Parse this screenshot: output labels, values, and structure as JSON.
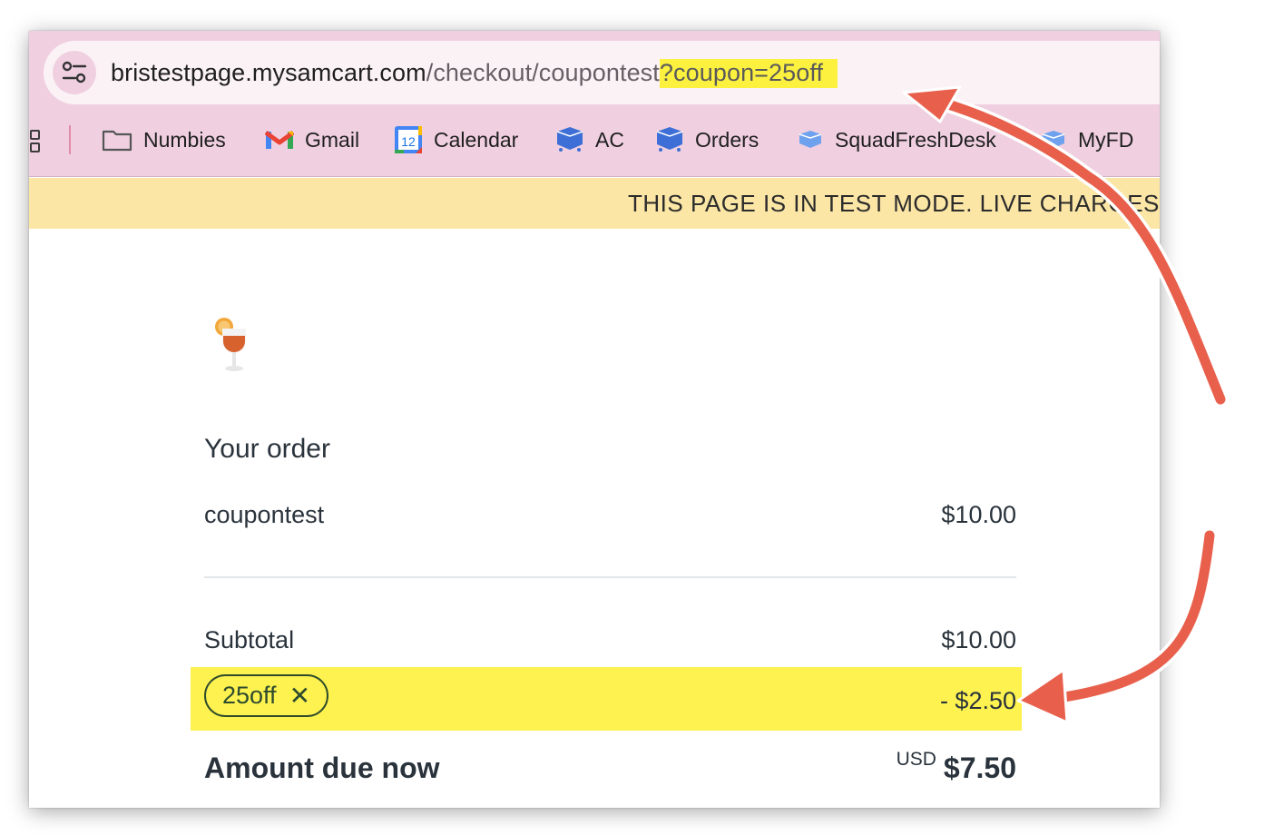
{
  "browser": {
    "url_host": "bristestpage.mysamcart.com",
    "url_path": "/checkout/coupontest",
    "url_query": "?coupon=25off",
    "bookmarks": [
      {
        "label": "Numbies",
        "icon": "folder-icon"
      },
      {
        "label": "Gmail",
        "icon": "gmail-icon"
      },
      {
        "label": "Calendar",
        "icon": "calendar-icon"
      },
      {
        "label": "AC",
        "icon": "cube-icon"
      },
      {
        "label": "Orders",
        "icon": "cube-icon"
      },
      {
        "label": "SquadFreshDesk",
        "icon": "cube-icon"
      },
      {
        "label": "MyFD",
        "icon": "cube-icon"
      }
    ],
    "calendar_day": "12"
  },
  "banner": {
    "text": "THIS PAGE IS IN TEST MODE. LIVE CHARGES"
  },
  "order": {
    "title": "Your order",
    "item_name": "coupontest",
    "item_price": "$10.00",
    "subtotal_label": "Subtotal",
    "subtotal_value": "$10.00",
    "coupon_code": "25off",
    "coupon_remove": "✕",
    "discount_value": "- $2.50",
    "amount_due_label": "Amount due now",
    "currency": "USD",
    "amount_due_value": "$7.50"
  },
  "colors": {
    "chrome": "#f0d0e0",
    "highlight": "#fdf24f",
    "banner": "#fbe6a6",
    "arrow": "#e8604c"
  }
}
